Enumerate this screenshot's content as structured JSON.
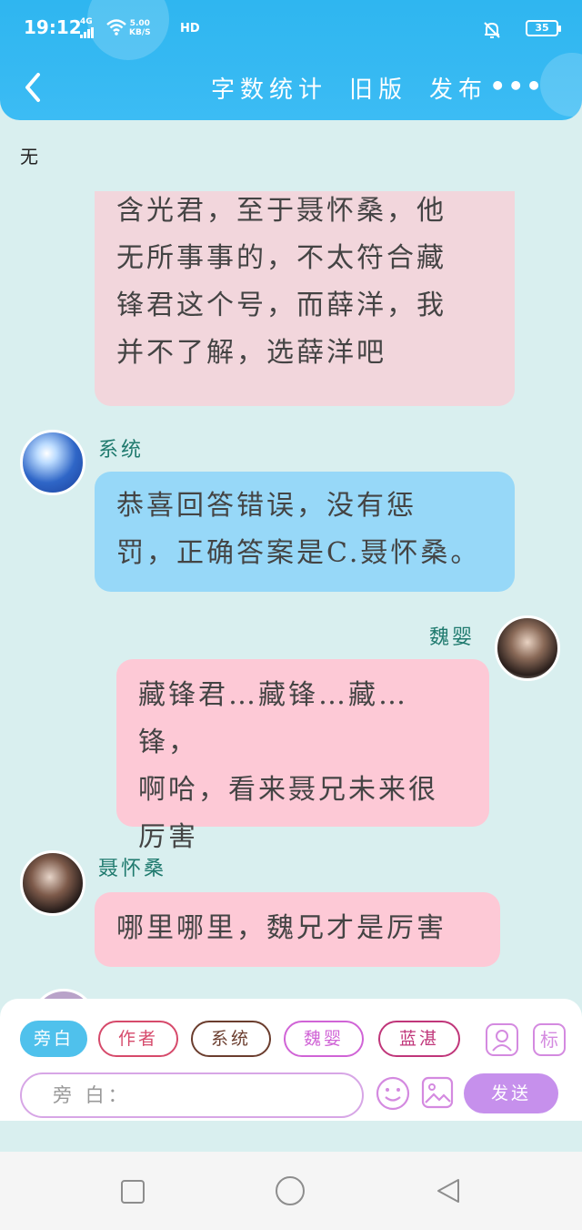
{
  "status_bar": {
    "time": "19:12",
    "network": "4G",
    "speed_value": "5.00",
    "speed_unit": "KB/S",
    "hd": "HD",
    "battery": "35"
  },
  "nav": {
    "word_count": "字数统计",
    "old_version": "旧版",
    "publish": "发布",
    "more": "•••"
  },
  "chat": {
    "top_sender": "无",
    "messages": [
      {
        "sender": "",
        "lines": [
          "含光君，至于聂怀桑，他",
          "无所事事的，不太符合藏",
          "锋君这个号，而薛洋，我",
          "并不了解，选薛洋吧"
        ]
      },
      {
        "sender": "系统",
        "lines": [
          "恭喜回答错误，没有惩",
          "罚，正确答案是C.聂怀桑。"
        ]
      },
      {
        "sender": "魏婴",
        "lines": [
          "藏锋君…藏锋…藏…锋，",
          "啊哈，看来聂兄未来很",
          "厉害"
        ]
      },
      {
        "sender": "聂怀桑",
        "lines": [
          "哪里哪里，魏兄才是厉害"
        ]
      }
    ]
  },
  "panel": {
    "roles": [
      "旁白",
      "作者",
      "系统",
      "魏婴",
      "蓝湛"
    ],
    "role_colors": [
      "#4fc1ec",
      "#d64a6b",
      "#6b3d2e",
      "#d064d6",
      "#c0367a"
    ],
    "tag_icon_label": "标",
    "input_placeholder": "旁 白：",
    "send_label": "发送"
  },
  "icons": [
    "back-icon",
    "bell-muted-icon",
    "wifi-icon",
    "person-icon",
    "emoji-icon",
    "image-icon",
    "square-icon",
    "circle-icon",
    "triangle-back-icon"
  ]
}
